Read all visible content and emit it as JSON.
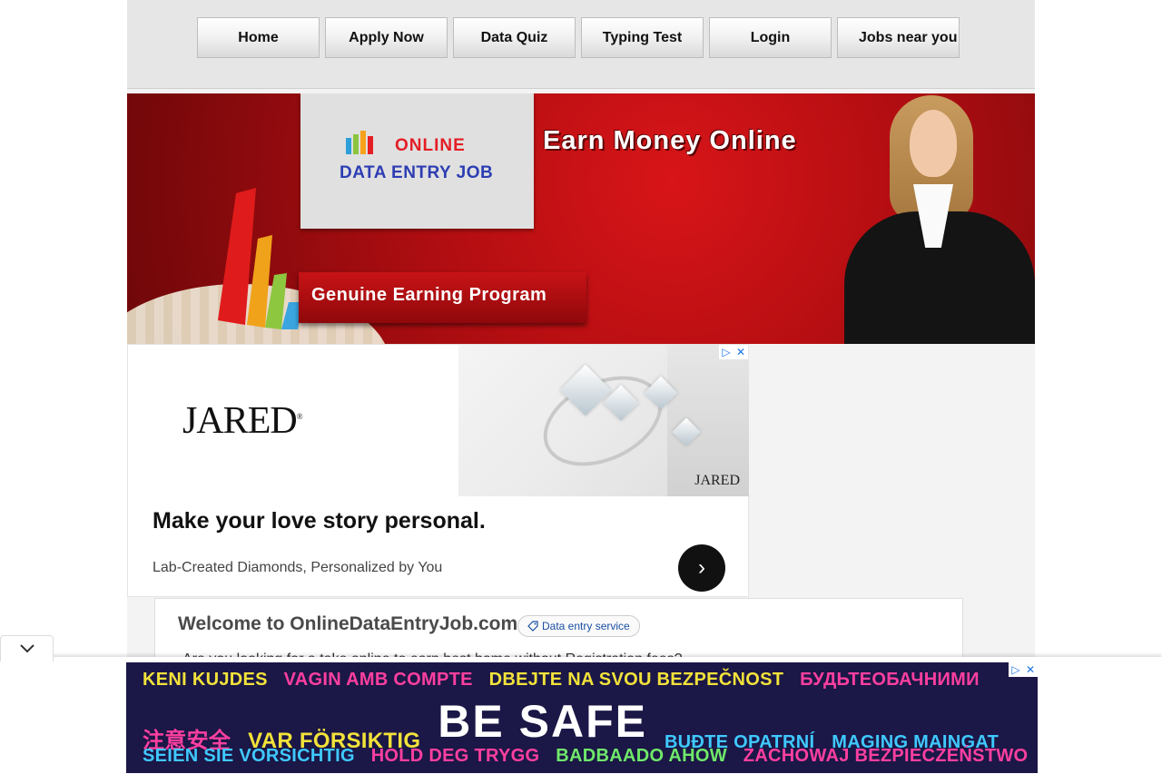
{
  "nav": {
    "items": [
      "Home",
      "Apply Now",
      "Data Quiz",
      "Typing Test",
      "Login",
      "Jobs near you"
    ]
  },
  "banner": {
    "logo_line1": "ONLINE",
    "logo_line2": "DATA ENTRY JOB",
    "headline": "Earn Money Online",
    "ribbon": "Genuine Earning Program"
  },
  "ad": {
    "brand": "JARED",
    "image_brand": "JARED",
    "headline": "Make your love story personal.",
    "subtext": "Lab-Created Diamonds, Personalized by You",
    "arrow": "›",
    "adchoices": "▷",
    "close": "✕"
  },
  "welcome": {
    "title": "Welcome to OnlineDataEntryJob.com",
    "tag": "Data entry service",
    "line": "Are you looking for a take online to earn best home without Registration fees?"
  },
  "collapse": {
    "icon": "chevron-down"
  },
  "bottom_ad": {
    "row1": [
      "KENI KUJDES",
      "VAGIN AMB COMPTE",
      "DBEJTE NA SVOU BEZPEČNOST",
      "БУДЬТЕОБАЧНИМИ"
    ],
    "row2_left": [
      "注意安全",
      "VAR FÖRSIKTIG"
    ],
    "row2_center": "BE SAFE",
    "row2_right": [
      "BUĐTE OPATRNÍ",
      "MAGING MAINGAT"
    ],
    "row3": [
      "SEIEN SIE VORSICHTIG",
      "HOLD DEG TRYGG",
      "BADBAADO AHOW",
      "ZACHOWAJ BEZPIECZEŃSTWO"
    ],
    "colors": {
      "yellow": "#f2e23a",
      "pink": "#ff3fa0",
      "cyan": "#3fc9ff",
      "green": "#6fe86a"
    },
    "adchoices": "▷",
    "close": "✕"
  }
}
